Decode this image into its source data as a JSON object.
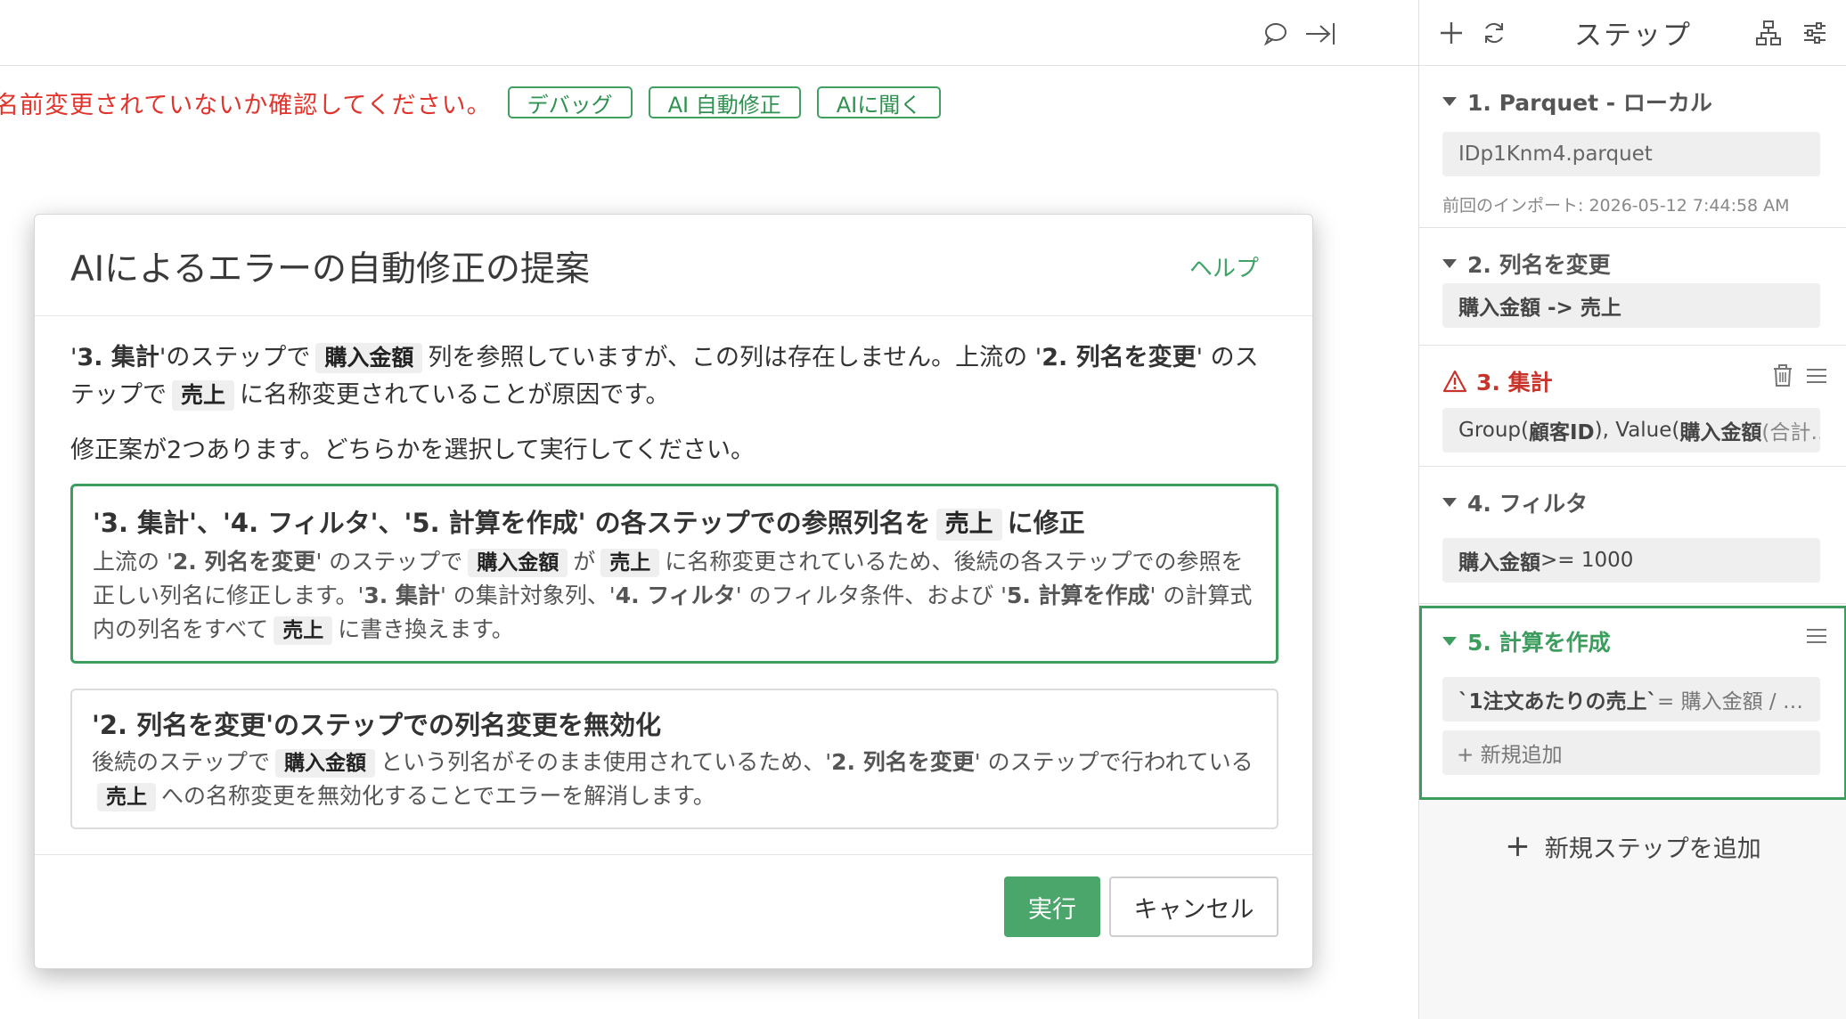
{
  "error_bar": {
    "message": "名前変更されていないか確認してください。",
    "buttons": [
      "デバッグ",
      "AI 自動修正",
      "AIに聞く"
    ]
  },
  "modal": {
    "title": "AIによるエラーの自動修正の提案",
    "help_label": "ヘルプ",
    "intro": {
      "p1": "'",
      "s1": "3. 集計",
      "p2": "'のステップで",
      "c1": "購入金額",
      "p3": "列を参照していますが、この列は存在しません。上流の '",
      "s2": "2. 列名を変更",
      "p4": "' のステップで",
      "c2": "売上",
      "p5": "に名称変更されていることが原因です。"
    },
    "choose_text": "修正案が2つあります。どちらかを選択して実行してください。",
    "option1": {
      "title_a": "'3. 集計'、'4. フィルタ'、'5. 計算を作成' の各ステップでの参照列名を",
      "title_code": "売上",
      "title_b": "に修正",
      "d1": "上流の '",
      "d2": "2. 列名を変更",
      "d3": "' のステップで",
      "d4": "購入金額",
      "d5": "が",
      "d6": "売上",
      "d7": "に名称変更されているため、後続の各ステップでの参照を正しい列名に修正します。'",
      "d8": "3. 集計",
      "d9": "' の集計対象列、'",
      "d10": "4. フィルタ",
      "d11": "' のフィルタ条件、および '",
      "d12": "5. 計算を作成",
      "d13": "' の計算式内の列名をすべて",
      "d14": "売上",
      "d15": "に書き換えます。"
    },
    "option2": {
      "title": "'2. 列名を変更'のステップでの列名変更を無効化",
      "d1": "後続のステップで",
      "d2": "購入金額",
      "d3": "という列名がそのまま使用されているため、'",
      "d4": "2. 列名を変更",
      "d5": "' のステップで行われている",
      "d6": "売上",
      "d7": "への名称変更を無効化することでエラーを解消します。"
    },
    "run_label": "実行",
    "cancel_label": "キャンセル"
  },
  "steps_panel": {
    "title": "ステップ",
    "add_new_step": "新規ステップを追加",
    "steps": [
      {
        "title": "1. Parquet - ローカル",
        "value": "IDp1Knm4.parquet",
        "meta": "前回のインポート: 2026-05-12 7:44:58 AM"
      },
      {
        "title": "2. 列名を変更",
        "value": "購入金額 -> 売上"
      },
      {
        "title": "3. 集計",
        "value_a": "Group(",
        "value_b": "顧客ID",
        "value_c": "), Value(",
        "value_d": "購入金額",
        "value_e": " (合計…",
        "status": "error"
      },
      {
        "title": "4. フィルタ",
        "value_a": "購入金額",
        "value_b": " >= 1000"
      },
      {
        "title": "5. 計算を作成",
        "value_a": "`1注文あたりの売上`",
        "value_b": " = 購入金額 / …",
        "add_label": "+ 新規追加",
        "status": "selected"
      }
    ]
  },
  "colors": {
    "accent_green": "#3d9d5e",
    "error_red": "#e0342c"
  },
  "icons": [
    "comment-icon",
    "collapse-right-icon",
    "plus-icon",
    "refresh-icon",
    "flow-icon",
    "settings-icon",
    "warning-icon",
    "trash-icon",
    "menu-icon"
  ]
}
